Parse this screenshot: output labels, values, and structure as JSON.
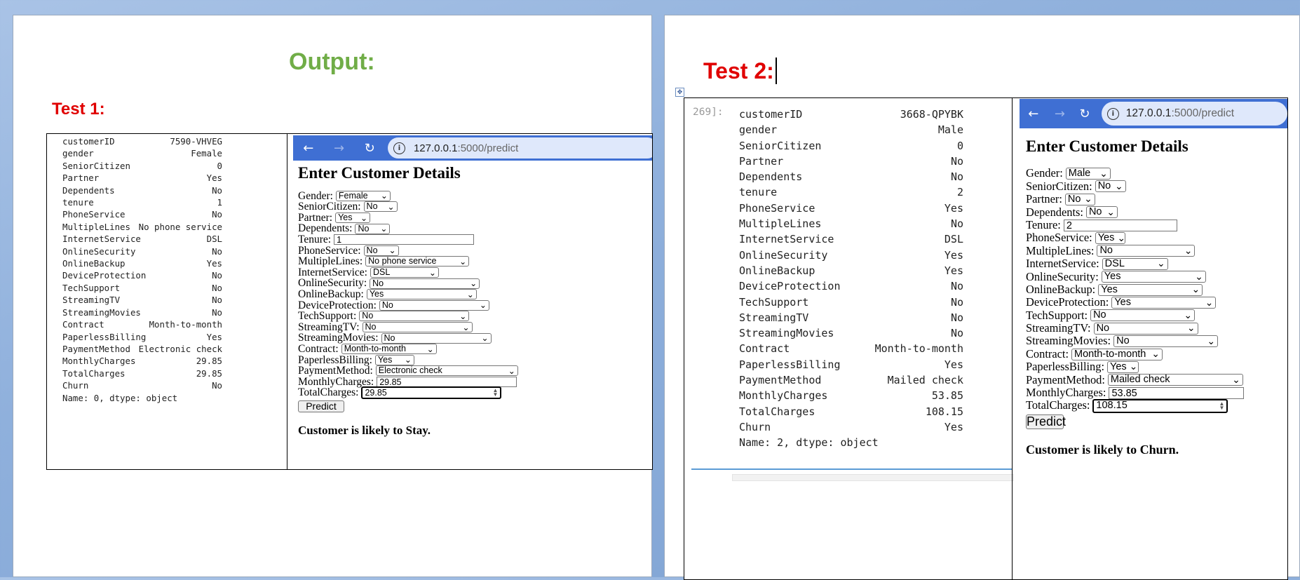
{
  "page1": {
    "output_heading": "Output:",
    "test_heading": "Test 1:",
    "series": {
      "rows": [
        {
          "k": "customerID",
          "v": "7590-VHVEG"
        },
        {
          "k": "gender",
          "v": "Female"
        },
        {
          "k": "SeniorCitizen",
          "v": "0"
        },
        {
          "k": "Partner",
          "v": "Yes"
        },
        {
          "k": "Dependents",
          "v": "No"
        },
        {
          "k": "tenure",
          "v": "1"
        },
        {
          "k": "PhoneService",
          "v": "No"
        },
        {
          "k": "MultipleLines",
          "v": "No phone service"
        },
        {
          "k": "InternetService",
          "v": "DSL"
        },
        {
          "k": "OnlineSecurity",
          "v": "No"
        },
        {
          "k": "OnlineBackup",
          "v": "Yes"
        },
        {
          "k": "DeviceProtection",
          "v": "No"
        },
        {
          "k": "TechSupport",
          "v": "No"
        },
        {
          "k": "StreamingTV",
          "v": "No"
        },
        {
          "k": "StreamingMovies",
          "v": "No"
        },
        {
          "k": "Contract",
          "v": "Month-to-month"
        },
        {
          "k": "PaperlessBilling",
          "v": "Yes"
        },
        {
          "k": "PaymentMethod",
          "v": "Electronic check"
        },
        {
          "k": "MonthlyCharges",
          "v": "29.85"
        },
        {
          "k": "TotalCharges",
          "v": "29.85"
        },
        {
          "k": "Churn",
          "v": "No"
        }
      ],
      "footer": "Name: 0, dtype: object"
    },
    "browser": {
      "url_host": "127.0.0.1",
      "url_path": ":5000/predict"
    },
    "form": {
      "title": "Enter Customer Details",
      "gender": {
        "label": "Gender:",
        "value": "Female"
      },
      "senior": {
        "label": "SeniorCitizen:",
        "value": "No"
      },
      "partner": {
        "label": "Partner:",
        "value": "Yes"
      },
      "dependents": {
        "label": "Dependents:",
        "value": "No"
      },
      "tenure": {
        "label": "Tenure:",
        "value": "1"
      },
      "phone": {
        "label": "PhoneService:",
        "value": "No"
      },
      "multiple": {
        "label": "MultipleLines:",
        "value": "No phone service"
      },
      "internet": {
        "label": "InternetService:",
        "value": "DSL"
      },
      "security": {
        "label": "OnlineSecurity:",
        "value": "No"
      },
      "backup": {
        "label": "OnlineBackup:",
        "value": "Yes"
      },
      "device": {
        "label": "DeviceProtection:",
        "value": "No"
      },
      "tech": {
        "label": "TechSupport:",
        "value": "No"
      },
      "tv": {
        "label": "StreamingTV:",
        "value": "No"
      },
      "movies": {
        "label": "StreamingMovies:",
        "value": "No"
      },
      "contract": {
        "label": "Contract:",
        "value": "Month-to-month"
      },
      "paperless": {
        "label": "PaperlessBilling:",
        "value": "Yes"
      },
      "payment": {
        "label": "PaymentMethod:",
        "value": "Electronic check"
      },
      "monthly": {
        "label": "MonthlyCharges:",
        "value": "29.85"
      },
      "total": {
        "label": "TotalCharges:",
        "value": "29.85"
      },
      "predict": "Predict",
      "result": "Customer is likely to Stay."
    }
  },
  "page2": {
    "test_heading": "Test 2:",
    "cell_prompt": "269]:",
    "series": {
      "rows": [
        {
          "k": "customerID",
          "v": "3668-QPYBK"
        },
        {
          "k": "gender",
          "v": "Male"
        },
        {
          "k": "SeniorCitizen",
          "v": "0"
        },
        {
          "k": "Partner",
          "v": "No"
        },
        {
          "k": "Dependents",
          "v": "No"
        },
        {
          "k": "tenure",
          "v": "2"
        },
        {
          "k": "PhoneService",
          "v": "Yes"
        },
        {
          "k": "MultipleLines",
          "v": "No"
        },
        {
          "k": "InternetService",
          "v": "DSL"
        },
        {
          "k": "OnlineSecurity",
          "v": "Yes"
        },
        {
          "k": "OnlineBackup",
          "v": "Yes"
        },
        {
          "k": "DeviceProtection",
          "v": "No"
        },
        {
          "k": "TechSupport",
          "v": "No"
        },
        {
          "k": "StreamingTV",
          "v": "No"
        },
        {
          "k": "StreamingMovies",
          "v": "No"
        },
        {
          "k": "Contract",
          "v": "Month-to-month"
        },
        {
          "k": "PaperlessBilling",
          "v": "Yes"
        },
        {
          "k": "PaymentMethod",
          "v": "Mailed check"
        },
        {
          "k": "MonthlyCharges",
          "v": "53.85"
        },
        {
          "k": "TotalCharges",
          "v": "108.15"
        },
        {
          "k": "Churn",
          "v": "Yes"
        }
      ],
      "footer": "Name: 2, dtype: object"
    },
    "browser": {
      "url_host": "127.0.0.1",
      "url_path": ":5000/predict"
    },
    "form": {
      "title": "Enter Customer Details",
      "gender": {
        "label": "Gender:",
        "value": "Male"
      },
      "senior": {
        "label": "SeniorCitizen:",
        "value": "No"
      },
      "partner": {
        "label": "Partner:",
        "value": "No"
      },
      "dependents": {
        "label": "Dependents:",
        "value": "No"
      },
      "tenure": {
        "label": "Tenure:",
        "value": "2"
      },
      "phone": {
        "label": "PhoneService:",
        "value": "Yes"
      },
      "multiple": {
        "label": "MultipleLines:",
        "value": "No"
      },
      "internet": {
        "label": "InternetService:",
        "value": "DSL"
      },
      "security": {
        "label": "OnlineSecurity:",
        "value": "Yes"
      },
      "backup": {
        "label": "OnlineBackup:",
        "value": "Yes"
      },
      "device": {
        "label": "DeviceProtection:",
        "value": "Yes"
      },
      "tech": {
        "label": "TechSupport:",
        "value": "No"
      },
      "tv": {
        "label": "StreamingTV:",
        "value": "No"
      },
      "movies": {
        "label": "StreamingMovies:",
        "value": "No"
      },
      "contract": {
        "label": "Contract:",
        "value": "Month-to-month"
      },
      "paperless": {
        "label": "PaperlessBilling:",
        "value": "Yes"
      },
      "payment": {
        "label": "PaymentMethod:",
        "value": "Mailed check"
      },
      "monthly": {
        "label": "MonthlyCharges:",
        "value": "53.85"
      },
      "total": {
        "label": "TotalCharges:",
        "value": "108.15"
      },
      "predict": "Predict",
      "result": "Customer is likely to Churn."
    }
  },
  "colors": {
    "output_heading": "#70ad47",
    "test_heading": "#e00000",
    "browser_bar": "#3f6fd3"
  },
  "icons": [
    "back-arrow-icon",
    "forward-arrow-icon",
    "reload-icon",
    "info-icon",
    "select-chevron-icon",
    "table-move-handle-icon",
    "number-spinner-icon"
  ]
}
